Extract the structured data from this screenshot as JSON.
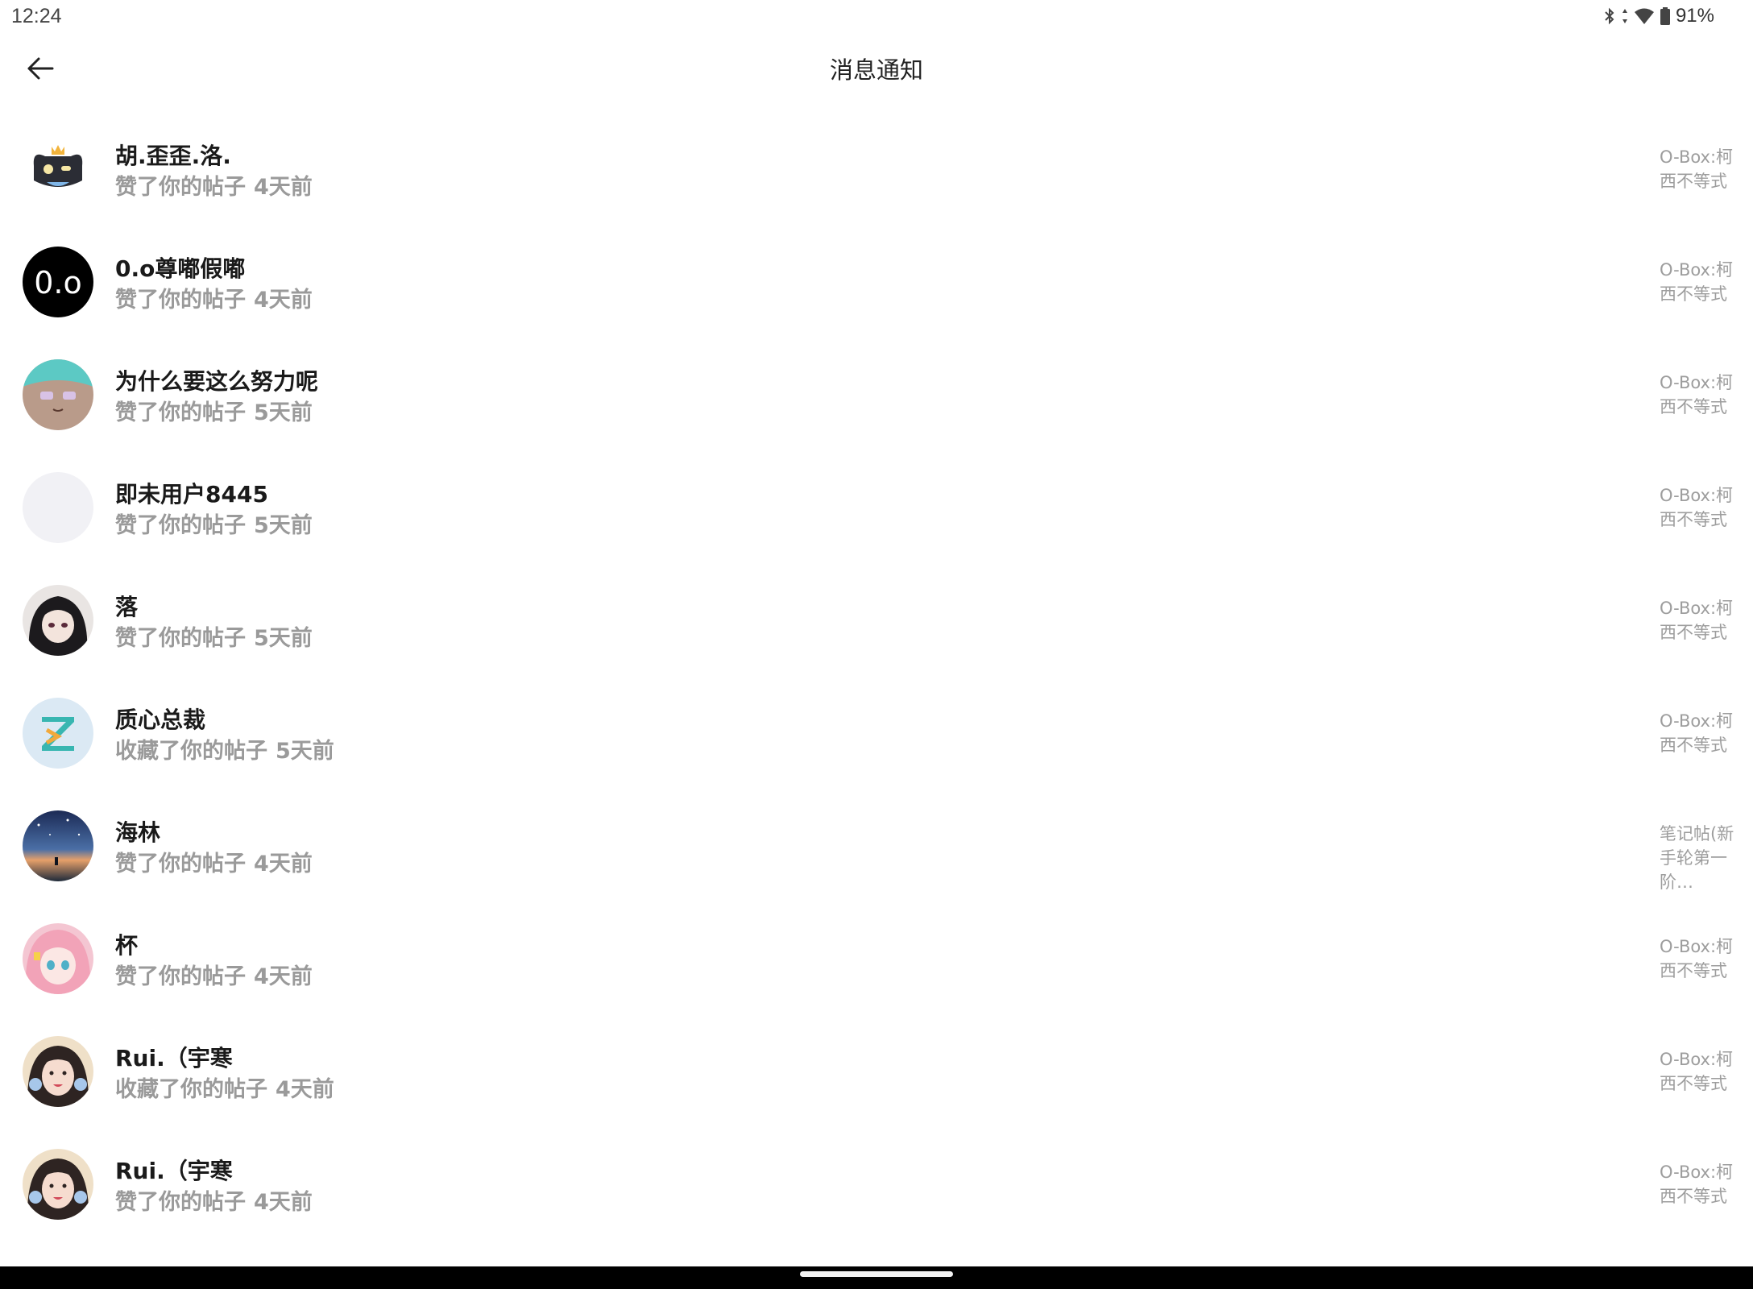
{
  "status_bar": {
    "time": "12:24",
    "battery": "91%"
  },
  "header": {
    "title": "消息通知"
  },
  "notifications": [
    {
      "name": "胡.歪歪.洛.",
      "action": "赞了你的帖子",
      "time": "4天前",
      "target": "O-Box:柯西不等式",
      "avatar": "cat-crown"
    },
    {
      "name": "0.o尊嘟假嘟",
      "action": "赞了你的帖子",
      "time": "4天前",
      "target": "O-Box:柯西不等式",
      "avatar": "text-0o"
    },
    {
      "name": "为什么要这么努力呢",
      "action": "赞了你的帖子",
      "time": "5天前",
      "target": "O-Box:柯西不等式",
      "avatar": "anime-cyan"
    },
    {
      "name": "即未用户8445",
      "action": "赞了你的帖子",
      "time": "5天前",
      "target": "O-Box:柯西不等式",
      "avatar": "blank"
    },
    {
      "name": "落",
      "action": "赞了你的帖子",
      "time": "5天前",
      "target": "O-Box:柯西不等式",
      "avatar": "anime-dark-hair"
    },
    {
      "name": "质心总裁",
      "action": "收藏了你的帖子",
      "time": "5天前",
      "target": "O-Box:柯西不等式",
      "avatar": "z-logo"
    },
    {
      "name": "海林",
      "action": "赞了你的帖子",
      "time": "4天前",
      "target": "笔记帖(新手轮第一阶…",
      "avatar": "night-sky"
    },
    {
      "name": "杯",
      "action": "赞了你的帖子",
      "time": "4天前",
      "target": "O-Box:柯西不等式",
      "avatar": "anime-pink"
    },
    {
      "name": "Rui.（宇寒",
      "action": "收藏了你的帖子",
      "time": "4天前",
      "target": "O-Box:柯西不等式",
      "avatar": "photo-girl"
    },
    {
      "name": "Rui.（宇寒",
      "action": "赞了你的帖子",
      "time": "4天前",
      "target": "O-Box:柯西不等式",
      "avatar": "photo-girl"
    }
  ],
  "avatar_text": {
    "text_0o": "0.o"
  },
  "colors": {
    "name": "#1a1a1a",
    "secondary": "#9a9a9a",
    "background": "#ffffff"
  }
}
